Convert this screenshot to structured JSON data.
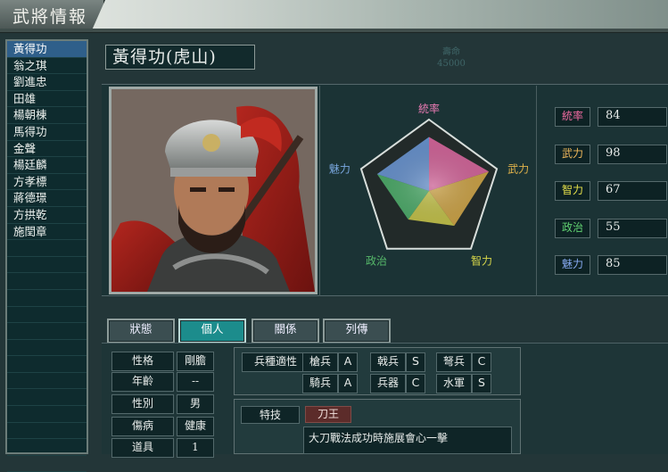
{
  "window": {
    "title": "武將情報"
  },
  "officers": [
    "黃得功",
    "翁之琪",
    "劉進忠",
    "田雄",
    "楊朝棟",
    "馬得功",
    "金聲",
    "楊廷麟",
    "方孝標",
    "蔣德璟",
    "方拱乾",
    "施閏章"
  ],
  "selected_index": 0,
  "name_plate": "黃得功(虎山)",
  "ghost_readout": [
    "壽命",
    "45000"
  ],
  "radar": {
    "labels": {
      "leadership": "統率",
      "war": "武力",
      "intelligence": "智力",
      "politics": "政治",
      "charm": "魅力"
    },
    "label_colors": {
      "leadership": "#e87ab2",
      "war": "#e0b24a",
      "intelligence": "#d9d84a",
      "politics": "#56b96a",
      "charm": "#7aa8e0"
    },
    "scale_max": 100
  },
  "stats": [
    {
      "key": "leadership",
      "label": "統率",
      "value": 84,
      "color": "#f06aa0"
    },
    {
      "key": "war",
      "label": "武力",
      "value": 98,
      "color": "#f0b85a"
    },
    {
      "key": "intelligence",
      "label": "智力",
      "value": 67,
      "color": "#e6e04a"
    },
    {
      "key": "politics",
      "label": "政治",
      "value": 55,
      "color": "#60d070"
    },
    {
      "key": "charm",
      "label": "魅力",
      "value": 85,
      "color": "#86a9f0"
    }
  ],
  "tabs": [
    {
      "label": "狀態",
      "active": false
    },
    {
      "label": "個人",
      "active": true
    },
    {
      "label": "關係",
      "active": false
    },
    {
      "label": "列傳",
      "active": false
    }
  ],
  "personal": [
    {
      "label": "性格",
      "value": "剛膽"
    },
    {
      "label": "年齡",
      "value": "--"
    },
    {
      "label": "性別",
      "value": "男"
    },
    {
      "label": "傷病",
      "value": "健康"
    },
    {
      "label": "道具",
      "value": "1"
    }
  ],
  "aptitude": {
    "title": "兵種適性",
    "cells": [
      {
        "name": "槍兵",
        "grade": "A"
      },
      {
        "name": "戟兵",
        "grade": "S"
      },
      {
        "name": "弩兵",
        "grade": "C"
      },
      {
        "name": "騎兵",
        "grade": "A"
      },
      {
        "name": "兵器",
        "grade": "C"
      },
      {
        "name": "水軍",
        "grade": "S"
      }
    ]
  },
  "skill": {
    "title": "特技",
    "name": "刀王",
    "description": "大刀戰法成功時施展會心一擊"
  }
}
